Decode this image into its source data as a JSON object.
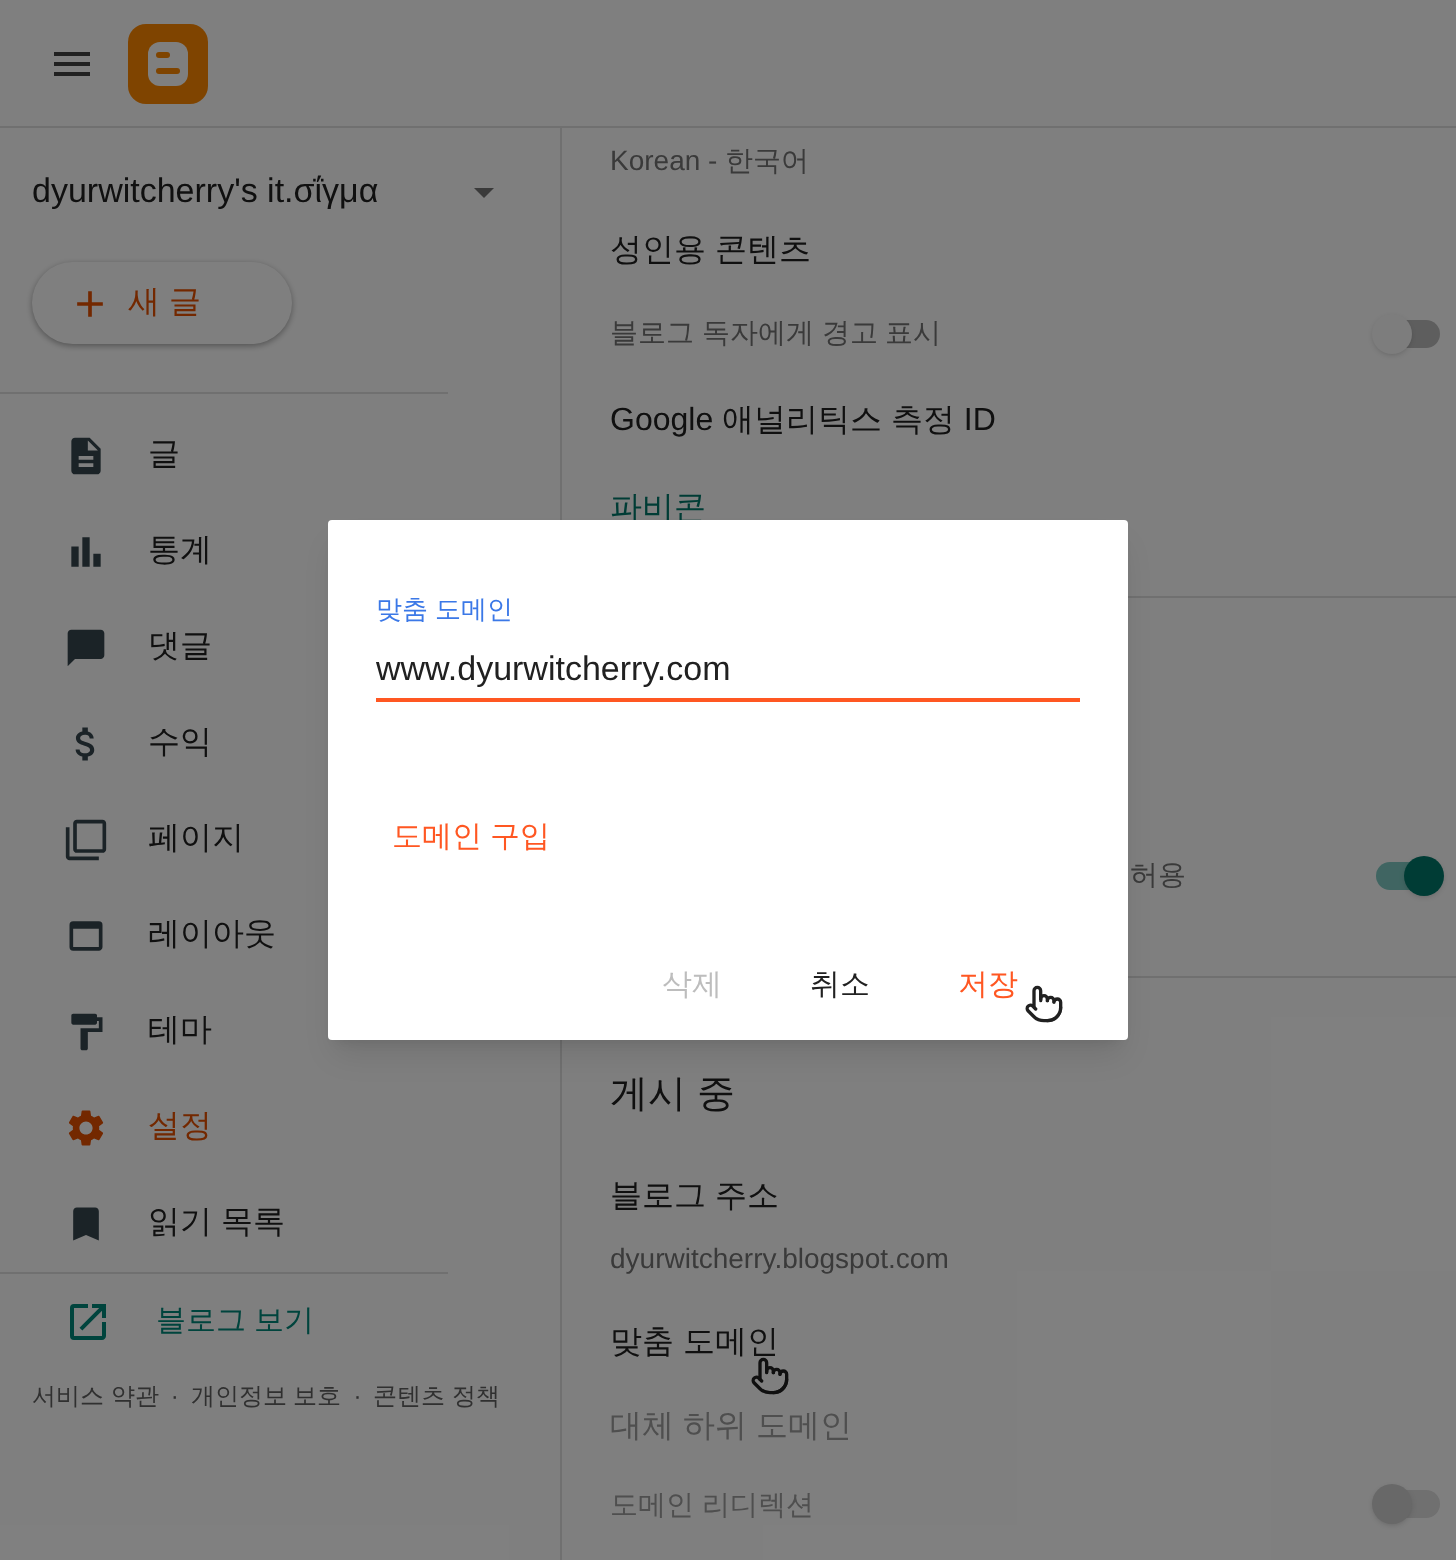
{
  "sidebar": {
    "blog_name": "dyurwitcherry's it.σΐγμα",
    "new_post": "새 글",
    "nav": [
      {
        "label": "글",
        "selected": false
      },
      {
        "label": "통계",
        "selected": false
      },
      {
        "label": "댓글",
        "selected": false
      },
      {
        "label": "수익",
        "selected": false
      },
      {
        "label": "페이지",
        "selected": false
      },
      {
        "label": "레이아웃",
        "selected": false
      },
      {
        "label": "테마",
        "selected": false
      },
      {
        "label": "설정",
        "selected": true
      },
      {
        "label": "읽기 목록",
        "selected": false
      }
    ],
    "view_blog": "블로그 보기",
    "footer": {
      "links": [
        "서비스 약관",
        "개인정보 보호",
        "콘텐츠 정책"
      ],
      "separator": "·"
    }
  },
  "settings": {
    "upper": [
      {
        "kind": "value",
        "text": "Korean - 한국어"
      },
      {
        "kind": "heading",
        "text": "성인용 콘텐츠"
      },
      {
        "kind": "toggle",
        "text": "블로그 독자에게 경고 표시",
        "on": false,
        "disabled": false
      },
      {
        "kind": "heading",
        "text": "Google 애널리틱스 측정 ID"
      },
      {
        "kind": "link",
        "text": "파비콘"
      }
    ],
    "partial_row": {
      "text": "허용",
      "on": true,
      "disabled": false
    },
    "lower": [
      {
        "kind": "section",
        "text": "게시 중"
      },
      {
        "kind": "heading",
        "text": "블로그 주소"
      },
      {
        "kind": "value",
        "text": "dyurwitcherry.blogspot.com"
      },
      {
        "kind": "heading",
        "text": "맞춤 도메인"
      },
      {
        "kind": "muted",
        "text": "대체 하위 도메인"
      },
      {
        "kind": "toggle",
        "text": "도메인 리디렉션",
        "on": false,
        "disabled": true
      }
    ]
  },
  "dialog": {
    "field_label": "맞춤 도메인",
    "field_value": "www.dyurwitcherry.com",
    "buy_link": "도메인 구입",
    "buttons": [
      {
        "label": "삭제",
        "kind": "disabled"
      },
      {
        "label": "취소",
        "kind": "default"
      },
      {
        "label": "저장",
        "kind": "primary"
      }
    ]
  }
}
